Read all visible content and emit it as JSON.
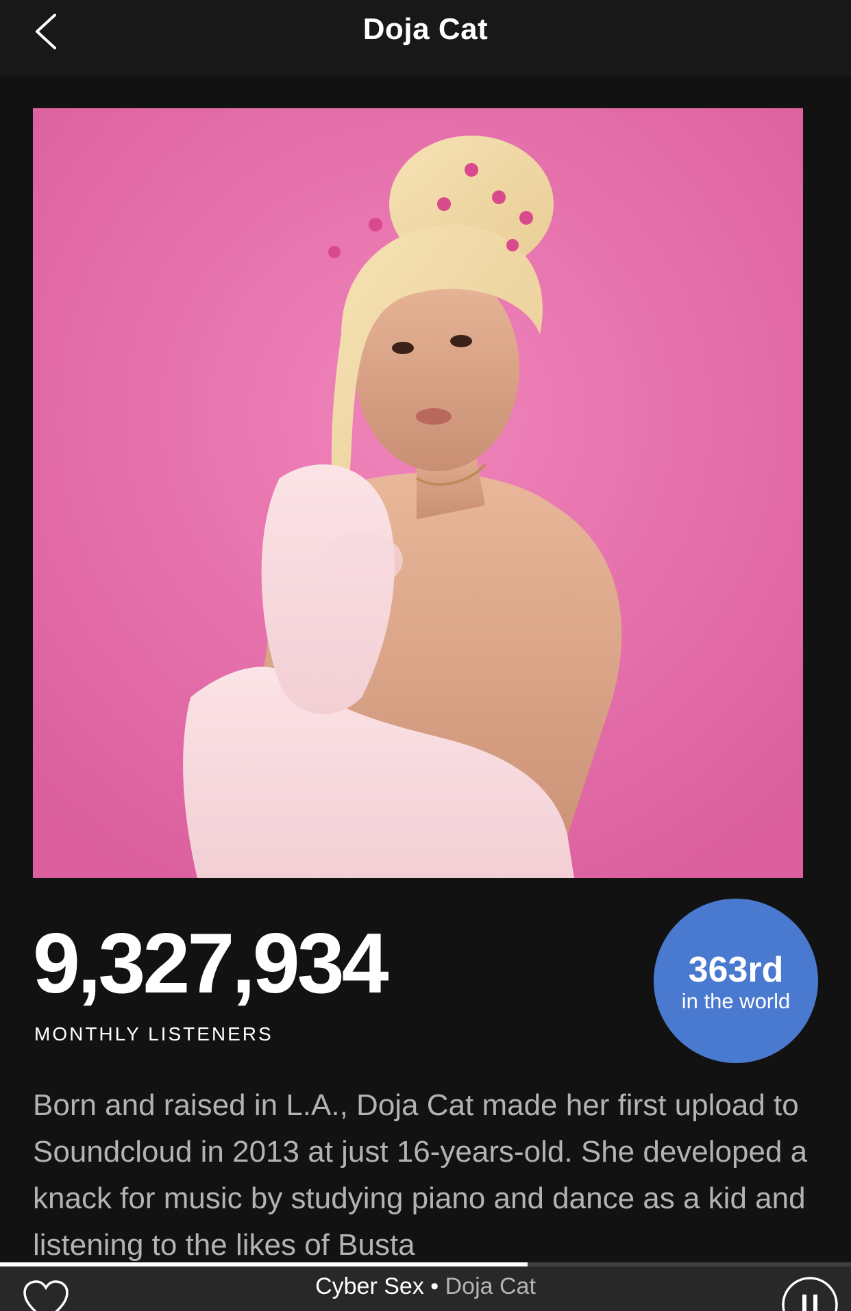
{
  "header": {
    "title": "Doja Cat",
    "back_icon": "chevron-left-icon"
  },
  "artist_photo": {
    "background_color": "#e26aa5"
  },
  "stats": {
    "monthly_listeners": "9,327,934",
    "monthly_listeners_label": "MONTHLY LISTENERS",
    "rank": "363rd",
    "rank_sub": "in the world",
    "rank_badge_color": "#4a7ad0"
  },
  "bio": {
    "text": "Born and raised in L.A., Doja Cat made her first upload to Soundcloud in 2013 at just 16-years-old. She developed a knack for music by studying piano and dance as a kid and listening to the likes of Busta"
  },
  "now_playing": {
    "track": "Cyber Sex",
    "separator": " • ",
    "artist": "Doja Cat",
    "progress": 0.62,
    "like_icon": "heart-icon",
    "pause_icon": "pause-icon"
  }
}
